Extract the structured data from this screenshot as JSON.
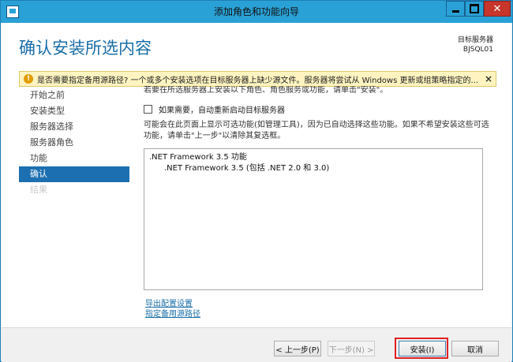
{
  "window": {
    "title": "添加角色和功能向导"
  },
  "header": {
    "page_title": "确认安装所选内容",
    "target_label": "目标服务器",
    "target_name": "BJSQL01"
  },
  "warning": {
    "text": "是否需要指定备用源路径? 一个或多个安装选项在目标服务器上缺少源文件。服务器将尝试从 Windows 更新或组策略指定的...",
    "close_symbol": "×"
  },
  "nav": {
    "items": [
      {
        "label": "开始之前",
        "state": "normal"
      },
      {
        "label": "安装类型",
        "state": "normal"
      },
      {
        "label": "服务器选择",
        "state": "normal"
      },
      {
        "label": "服务器角色",
        "state": "normal"
      },
      {
        "label": "功能",
        "state": "normal"
      },
      {
        "label": "确认",
        "state": "active"
      },
      {
        "label": "结果",
        "state": "disabled"
      }
    ]
  },
  "main": {
    "intro": "若要在所选服务器上安装以下角色、角色服务或功能，请单击\"安装\"。",
    "restart_checkbox_label": "如果需要，自动重新启动目标服务器",
    "note": "可能会在此页面上显示可选功能(如管理工具)，因为已自动选择这些功能。如果不希望安装这些可选功能，请单击\"上一步\"以清除其复选框。",
    "features": [
      {
        "text": ".NET Framework 3.5 功能",
        "level": 0
      },
      {
        "text": ".NET Framework 3.5 (包括 .NET 2.0 和 3.0)",
        "level": 1
      }
    ],
    "links": {
      "export": "导出配置设置",
      "alt_source": "指定备用源路径"
    }
  },
  "buttons": {
    "prev": "< 上一步(P)",
    "next": "下一步(N) >",
    "install": "安装(I)",
    "cancel": "取消"
  },
  "colors": {
    "accent": "#1c6fb0",
    "titlebar": "#2aa1d6",
    "warning_bg": "#fff4c1",
    "highlight": "#e02020"
  }
}
